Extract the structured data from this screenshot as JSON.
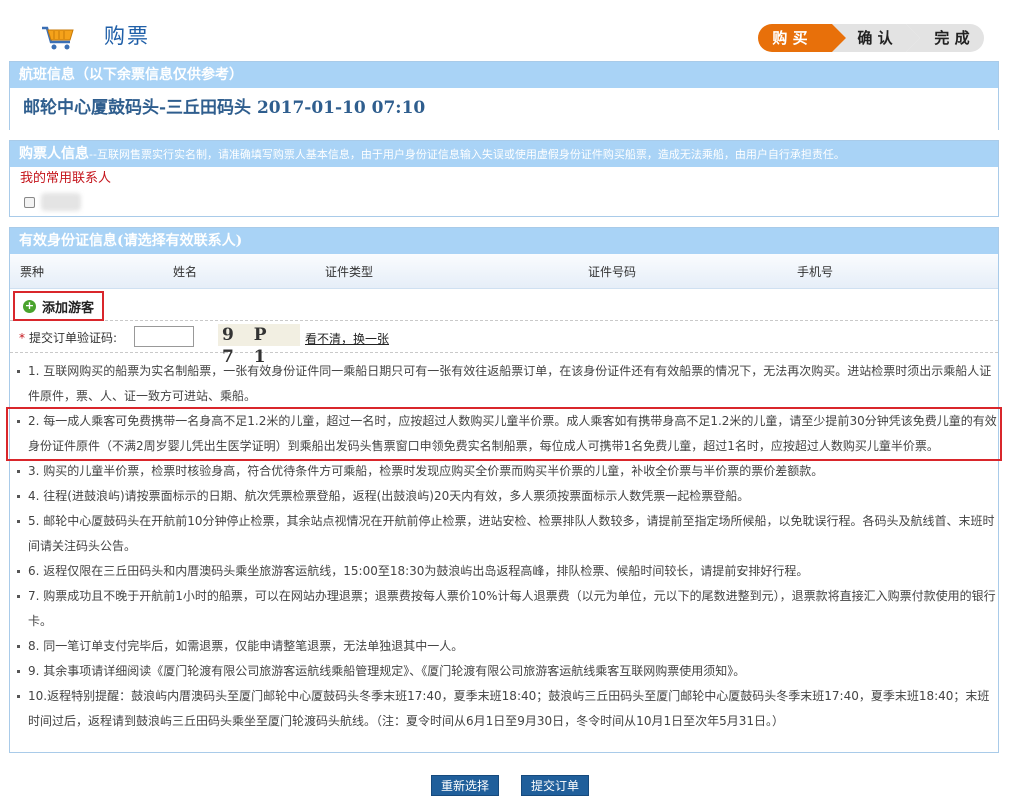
{
  "header": {
    "title": "购票",
    "steps": [
      "购 买",
      "确 认",
      "完 成"
    ]
  },
  "flight": {
    "heading": "航班信息（以下余票信息仅供参考）",
    "route": "邮轮中心厦鼓码头-三丘田码头  2017-01-10  07:10"
  },
  "buyer": {
    "heading": "购票人信息",
    "note": "--互联网售票实行实名制，请准确填写购票人基本信息，由于用户身份证信息输入失误或使用虚假身份证件购买船票，造成无法乘船，由用户自行承担责任。",
    "contacts_label": "我的常用联系人"
  },
  "ids": {
    "heading": "有效身份证信息(请选择有效联系人)",
    "columns": [
      "票种",
      "姓名",
      "证件类型",
      "证件号码",
      "手机号"
    ],
    "add_label": "添加游客",
    "verify_label": "提交订单验证码:",
    "captcha_text": "9 P 7 1",
    "captcha_link": "看不清，换一张"
  },
  "rules": [
    "1. 互联网购买的船票为实名制船票，一张有效身份证件同一乘船日期只可有一张有效往返船票订单，在该身份证件还有有效船票的情况下，无法再次购买。进站检票时须出示乘船人证件原件，票、人、证一致方可进站、乘船。",
    "2. 每一成人乘客可免费携带一名身高不足1.2米的儿童，超过一名时，应按超过人数购买儿童半价票。成人乘客如有携带身高不足1.2米的儿童，请至少提前30分钟凭该免费儿童的有效身份证件原件（不满2周岁婴儿凭出生医学证明）到乘船出发码头售票窗口申领免费实名制船票，每位成人可携带1名免费儿童，超过1名时，应按超过人数购买儿童半价票。",
    "3. 购买的儿童半价票，检票时核验身高，符合优待条件方可乘船，检票时发现应购买全价票而购买半价票的儿童，补收全价票与半价票的票价差额款。",
    "4. 往程(进鼓浪屿)请按票面标示的日期、航次凭票检票登船，返程(出鼓浪屿)20天内有效，多人票须按票面标示人数凭票一起检票登船。",
    "5. 邮轮中心厦鼓码头在开航前10分钟停止检票，其余站点视情况在开航前停止检票，进站安检、检票排队人数较多，请提前至指定场所候船，以免耽误行程。各码头及航线首、末班时间请关注码头公告。",
    "6. 返程仅限在三丘田码头和内厝澳码头乘坐旅游客运航线，15:00至18:30为鼓浪屿出岛返程高峰，排队检票、候船时间较长，请提前安排好行程。",
    "7. 购票成功且不晚于开航前1小时的船票，可以在网站办理退票；退票费按每人票价10%计每人退票费（以元为单位，元以下的尾数进整到元），退票款将直接汇入购票付款使用的银行卡。",
    "8. 同一笔订单支付完毕后，如需退票，仅能申请整笔退票，无法单独退其中一人。",
    "9. 其余事项请详细阅读《厦门轮渡有限公司旅游客运航线乘船管理规定》、《厦门轮渡有限公司旅游客运航线乘客互联网购票使用须知》。",
    "10.返程特别提醒：鼓浪屿内厝澳码头至厦门邮轮中心厦鼓码头冬季末班17:40，夏季末班18:40；鼓浪屿三丘田码头至厦门邮轮中心厦鼓码头冬季末班17:40，夏季末班18:40；末班时间过后，返程请到鼓浪屿三丘田码头乘坐至厦门轮渡码头航线。（注：夏令时间从6月1日至9月30日，冬令时间从10月1日至次年5月31日。）"
  ],
  "buttons": {
    "reset": "重新选择",
    "submit": "提交订单"
  },
  "colors": {
    "accent_orange": "#e8700a",
    "header_blue": "#a9d3f6",
    "title_blue": "#1f5fa8",
    "highlight_red": "#d9262b",
    "button_blue": "#205f9b"
  }
}
